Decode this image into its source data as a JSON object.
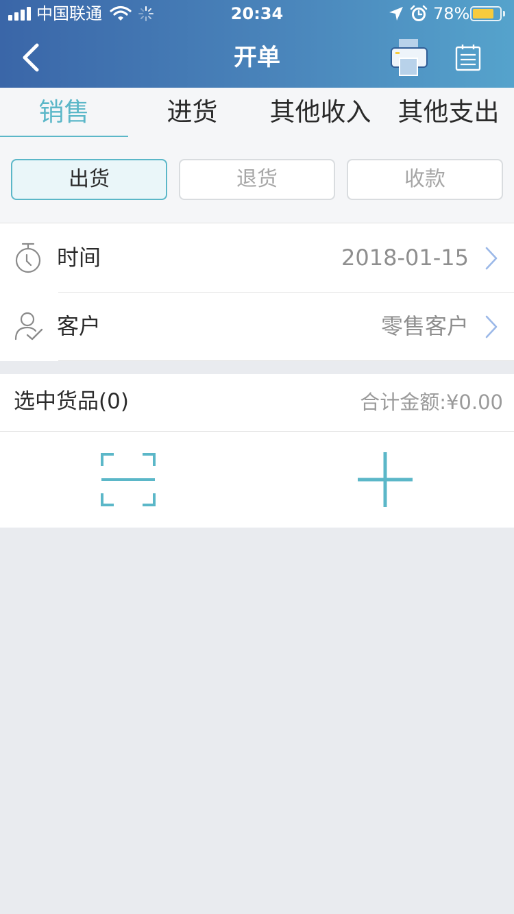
{
  "status_bar": {
    "carrier": "中国联通",
    "time": "20:34",
    "battery_percent": "78%",
    "battery_level": 0.78,
    "icons": [
      "signal-icon",
      "wifi-icon",
      "activity-spinner-icon",
      "location-arrow-icon",
      "alarm-icon",
      "battery-icon"
    ]
  },
  "nav": {
    "title": "开单",
    "icons": [
      "back-chevron-icon",
      "printer-icon",
      "notepad-icon"
    ]
  },
  "tabs": [
    {
      "label": "销售",
      "active": true
    },
    {
      "label": "进货",
      "active": false
    },
    {
      "label": "其他收入",
      "active": false
    },
    {
      "label": "其他支出",
      "active": false
    }
  ],
  "segments": [
    {
      "label": "出货",
      "active": true
    },
    {
      "label": "退货",
      "active": false
    },
    {
      "label": "收款",
      "active": false
    }
  ],
  "info": {
    "time": {
      "label": "时间",
      "value": "2018-01-15",
      "icon": "stopwatch-icon"
    },
    "customer": {
      "label": "客户",
      "value": "零售客户",
      "icon": "user-check-icon"
    }
  },
  "goods": {
    "title": "选中货品(0)",
    "total": "合计金额:¥0.00"
  },
  "actions": {
    "icons": [
      "scan-icon",
      "add-icon"
    ]
  },
  "colors": {
    "accent": "#5bb7c8",
    "header_start": "#3a66a8",
    "header_end": "#55a3cc",
    "chevron": "#9bb8e8",
    "battery": "#f7cb3d"
  }
}
